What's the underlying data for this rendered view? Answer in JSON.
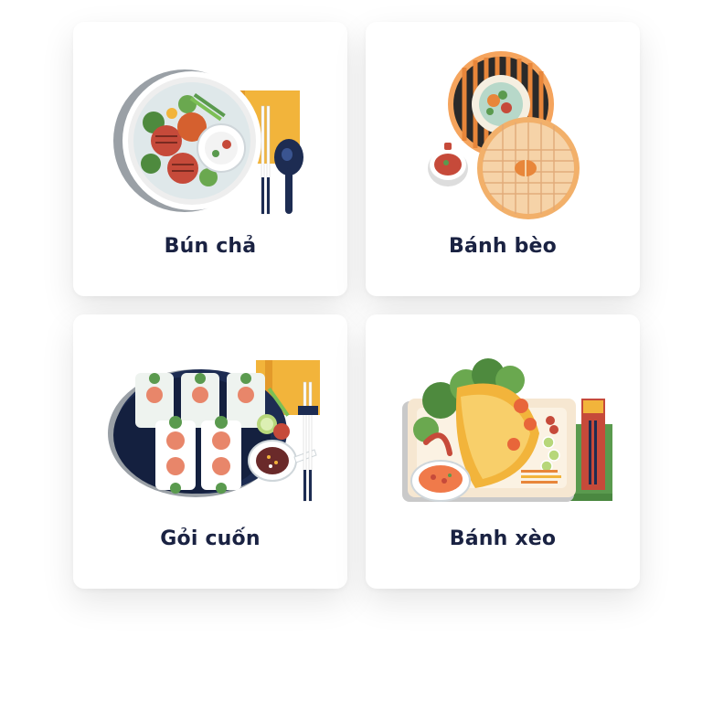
{
  "dishes": [
    {
      "name": "Bún chả",
      "illustration": "bun-cha-illustration"
    },
    {
      "name": "Bánh bèo",
      "illustration": "banh-beo-illustration"
    },
    {
      "name": "Gỏi cuốn",
      "illustration": "goi-cuon-illustration"
    },
    {
      "name": "Bánh xèo",
      "illustration": "banh-xeo-illustration"
    }
  ],
  "colors": {
    "label_text": "#1a2242",
    "card_bg": "#ffffff",
    "accent_yellow": "#f2b43b",
    "accent_orange": "#e8863a",
    "accent_green": "#5a9a4e",
    "navy": "#1d2c52"
  }
}
